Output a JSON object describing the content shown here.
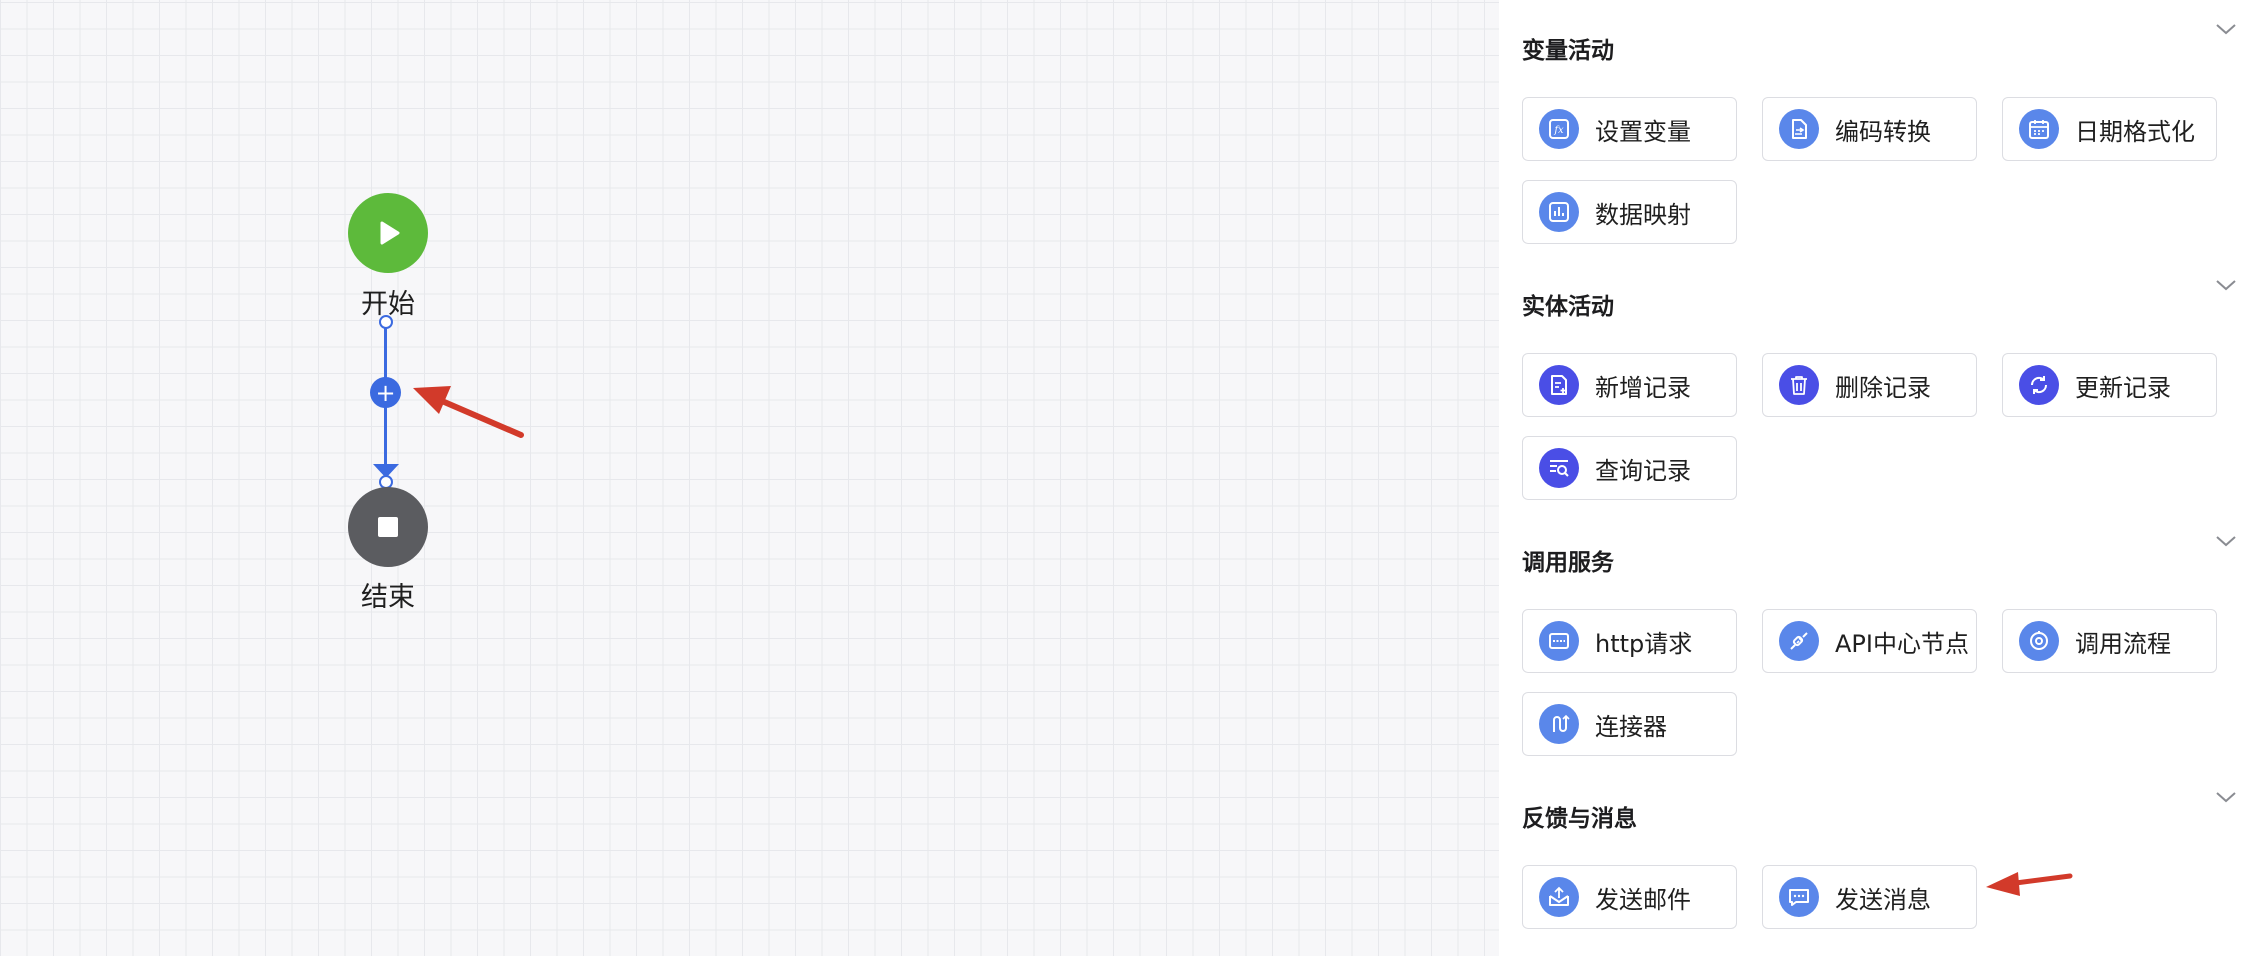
{
  "canvas": {
    "start_label": "开始",
    "end_label": "结束",
    "add_button_label": "+"
  },
  "panel": {
    "groups": [
      {
        "title": "变量活动",
        "items": [
          {
            "label": "设置变量",
            "icon": "fx-variable-icon",
            "color": "#5a87ea"
          },
          {
            "label": "编码转换",
            "icon": "file-convert-icon",
            "color": "#5a87ea"
          },
          {
            "label": "日期格式化",
            "icon": "calendar-icon",
            "color": "#5a87ea"
          },
          {
            "label": "数据映射",
            "icon": "data-map-icon",
            "color": "#5a87ea"
          }
        ]
      },
      {
        "title": "实体活动",
        "items": [
          {
            "label": "新增记录",
            "icon": "add-record-icon",
            "color": "#4a4ee6"
          },
          {
            "label": "删除记录",
            "icon": "trash-icon",
            "color": "#4a4ee6"
          },
          {
            "label": "更新记录",
            "icon": "refresh-icon",
            "color": "#4a4ee6"
          },
          {
            "label": "查询记录",
            "icon": "search-record-icon",
            "color": "#4a4ee6"
          }
        ]
      },
      {
        "title": "调用服务",
        "items": [
          {
            "label": "http请求",
            "icon": "http-icon",
            "color": "#5a87ea"
          },
          {
            "label": "API中心节点",
            "icon": "api-link-icon",
            "color": "#5a87ea"
          },
          {
            "label": "调用流程",
            "icon": "flow-call-icon",
            "color": "#5a87ea"
          },
          {
            "label": "连接器",
            "icon": "connector-icon",
            "color": "#5a87ea"
          }
        ]
      },
      {
        "title": "反馈与消息",
        "items": [
          {
            "label": "发送邮件",
            "icon": "mail-icon",
            "color": "#5a87ea"
          },
          {
            "label": "发送消息",
            "icon": "message-icon",
            "color": "#5a87ea"
          }
        ]
      }
    ]
  },
  "colors": {
    "start_node": "#5dba3b",
    "end_node": "#5b5c60",
    "edge": "#3b6ae0",
    "annotation_arrow": "#d23a2a"
  }
}
